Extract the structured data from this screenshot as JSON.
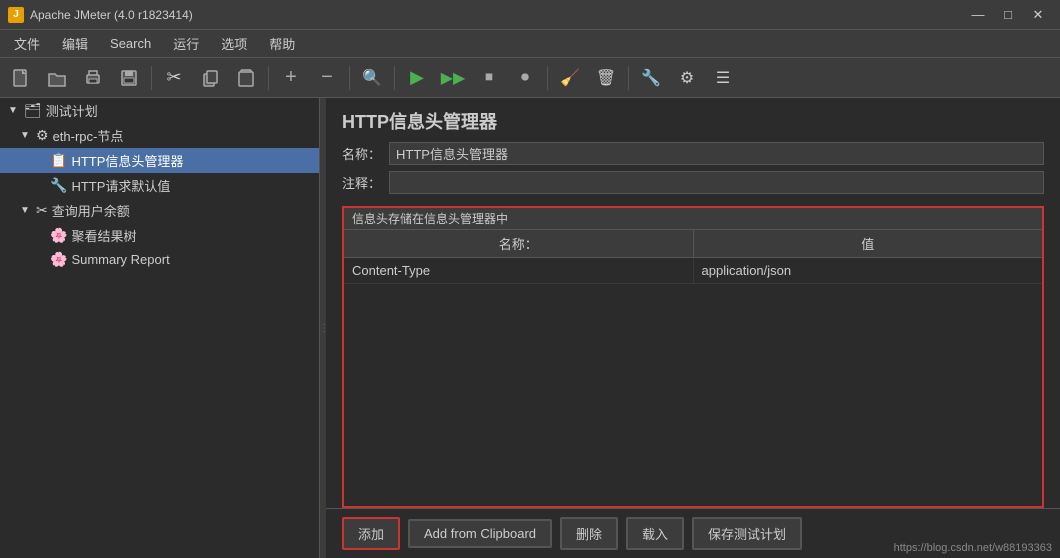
{
  "titleBar": {
    "icon": "J",
    "title": "Apache JMeter (4.0 r1823414)",
    "minimize": "—",
    "maximize": "□",
    "close": "✕"
  },
  "menuBar": {
    "items": [
      "文件",
      "编辑",
      "Search",
      "运行",
      "选项",
      "帮助"
    ]
  },
  "toolbar": {
    "buttons": [
      {
        "name": "new",
        "icon": "📄"
      },
      {
        "name": "open",
        "icon": "📁"
      },
      {
        "name": "save-template",
        "icon": "🖨"
      },
      {
        "name": "save",
        "icon": "💾"
      },
      {
        "name": "cut",
        "icon": "✂"
      },
      {
        "name": "copy",
        "icon": "📋"
      },
      {
        "name": "paste",
        "icon": "📌"
      },
      {
        "name": "add",
        "icon": "+"
      },
      {
        "name": "remove",
        "icon": "−"
      },
      {
        "name": "browse",
        "icon": "🔍"
      },
      {
        "name": "run",
        "icon": "▶"
      },
      {
        "name": "run-no-pause",
        "icon": "⏭"
      },
      {
        "name": "stop",
        "icon": "⏹"
      },
      {
        "name": "stop-all",
        "icon": "⏺"
      },
      {
        "name": "clear",
        "icon": "🧹"
      },
      {
        "name": "clear-all",
        "icon": "🗑"
      },
      {
        "name": "remote",
        "icon": "🔧"
      },
      {
        "name": "function",
        "icon": "⚙"
      },
      {
        "name": "template",
        "icon": "☰"
      }
    ]
  },
  "sidebar": {
    "items": [
      {
        "label": "测试计划",
        "level": 0,
        "arrow": "▼",
        "icon": "🗂",
        "selected": false
      },
      {
        "label": "eth-rpc-节点",
        "level": 1,
        "arrow": "▼",
        "icon": "⚙",
        "selected": false
      },
      {
        "label": "HTTP信息头管理器",
        "level": 2,
        "arrow": "",
        "icon": "📋",
        "selected": true
      },
      {
        "label": "HTTP请求默认值",
        "level": 2,
        "arrow": "",
        "icon": "🔧",
        "selected": false
      },
      {
        "label": "查询用户余额",
        "level": 1,
        "arrow": "▼",
        "icon": "✂",
        "selected": false
      },
      {
        "label": "聚看结果树",
        "level": 2,
        "arrow": "",
        "icon": "🌸",
        "selected": false
      },
      {
        "label": "Summary Report",
        "level": 2,
        "arrow": "",
        "icon": "🌸",
        "selected": false
      }
    ]
  },
  "content": {
    "title": "HTTP信息头管理器",
    "nameLabel": "名称：",
    "nameValue": "HTTP信息头管理器",
    "commentLabel": "注释：",
    "commentValue": "",
    "tableTitle": "信息头存储在信息头管理器中",
    "columns": [
      "名称：",
      "值"
    ],
    "rows": [
      {
        "name": "Content-Type",
        "value": "application/json"
      }
    ]
  },
  "bottomBar": {
    "addLabel": "添加",
    "clipboardLabel": "Add from Clipboard",
    "deleteLabel": "删除",
    "loadLabel": "载入",
    "saveLabel": "保存测试计划"
  },
  "watermark": "https://blog.csdn.net/w88193363"
}
